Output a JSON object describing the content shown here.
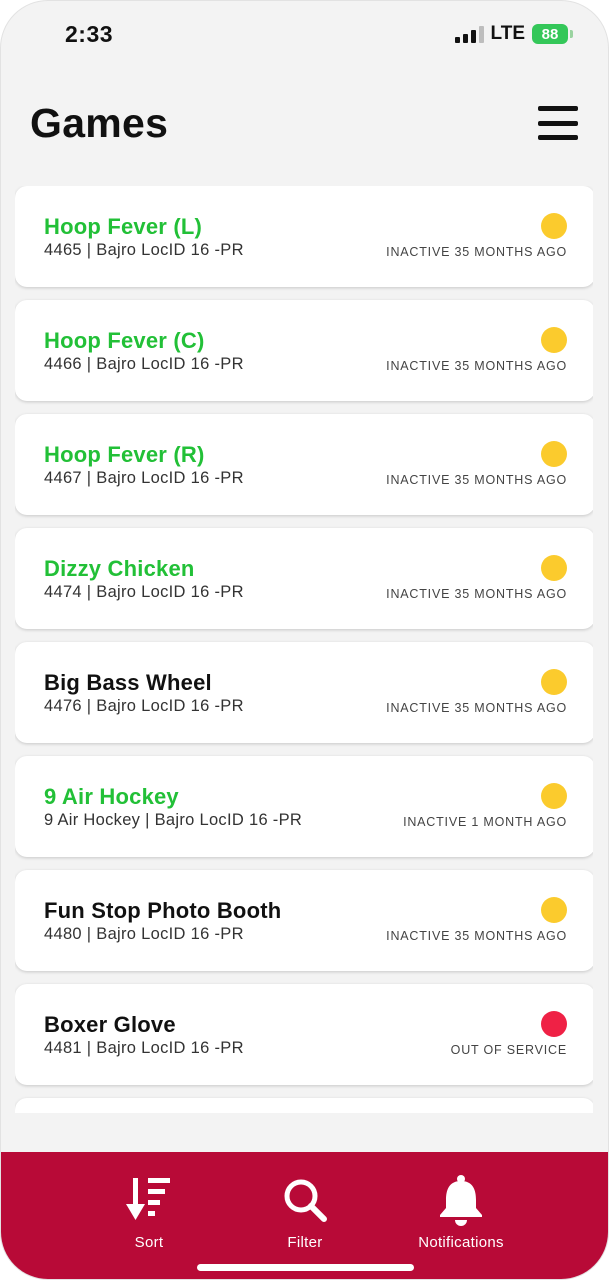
{
  "status_bar": {
    "time": "2:33",
    "network": "LTE",
    "battery": "88"
  },
  "header": {
    "title": "Games",
    "menu_icon": "hamburger-menu-icon"
  },
  "games": [
    {
      "name": "Hoop Fever (L)",
      "subtitle": "4465 | Bajro LocID 16 -PR",
      "status": "INACTIVE 35 MONTHS AGO",
      "name_color": "#22c037",
      "dot_color": "#fbcb2d"
    },
    {
      "name": "Hoop Fever (C)",
      "subtitle": "4466 | Bajro LocID 16 -PR",
      "status": "INACTIVE 35 MONTHS AGO",
      "name_color": "#22c037",
      "dot_color": "#fbcb2d"
    },
    {
      "name": "Hoop Fever (R)",
      "subtitle": "4467 | Bajro LocID 16 -PR",
      "status": "INACTIVE 35 MONTHS AGO",
      "name_color": "#22c037",
      "dot_color": "#fbcb2d"
    },
    {
      "name": "Dizzy Chicken",
      "subtitle": "4474 | Bajro LocID 16 -PR",
      "status": "INACTIVE 35 MONTHS AGO",
      "name_color": "#22c037",
      "dot_color": "#fbcb2d"
    },
    {
      "name": "Big Bass Wheel",
      "subtitle": "4476 | Bajro LocID 16 -PR",
      "status": "INACTIVE 35 MONTHS AGO",
      "name_color": "#111111",
      "dot_color": "#fbcb2d"
    },
    {
      "name": "9 Air Hockey",
      "subtitle": "9 Air Hockey | Bajro LocID 16 -PR",
      "status": "INACTIVE 1 MONTH AGO",
      "name_color": "#22c037",
      "dot_color": "#fbcb2d"
    },
    {
      "name": "Fun Stop Photo Booth",
      "subtitle": "4480 | Bajro LocID 16 -PR",
      "status": "INACTIVE 35 MONTHS AGO",
      "name_color": "#111111",
      "dot_color": "#fbcb2d"
    },
    {
      "name": "Boxer Glove",
      "subtitle": "4481 | Bajro LocID 16 -PR",
      "status": "OUT OF SERVICE",
      "name_color": "#111111",
      "dot_color": "#ef2145"
    }
  ],
  "tabbar": {
    "background": "#b80a37",
    "tabs": [
      {
        "label": "Sort",
        "icon": "sort-descending-icon"
      },
      {
        "label": "Filter",
        "icon": "search-icon"
      },
      {
        "label": "Notifications",
        "icon": "bell-icon"
      }
    ]
  },
  "colors": {
    "battery_fill": "#34c759",
    "accent_green": "#22c037",
    "warning_yellow": "#fbcb2d",
    "error_red": "#ef2145"
  }
}
